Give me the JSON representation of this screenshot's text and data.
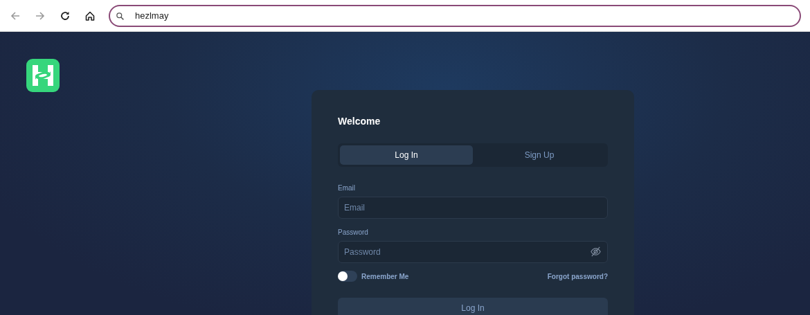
{
  "browser": {
    "address": "hezlmay"
  },
  "card": {
    "title": "Welcome",
    "tabs": [
      {
        "label": "Log In",
        "selected": true
      },
      {
        "label": "Sign Up",
        "selected": false
      }
    ],
    "fields": [
      {
        "label": "Email",
        "placeholder": "Email",
        "kind": "text"
      },
      {
        "label": "Password",
        "placeholder": "Password",
        "kind": "password"
      }
    ],
    "remember": {
      "label": "Remember Me",
      "on": false
    },
    "forgot": "Forgot password?",
    "submit": "Log In"
  }
}
